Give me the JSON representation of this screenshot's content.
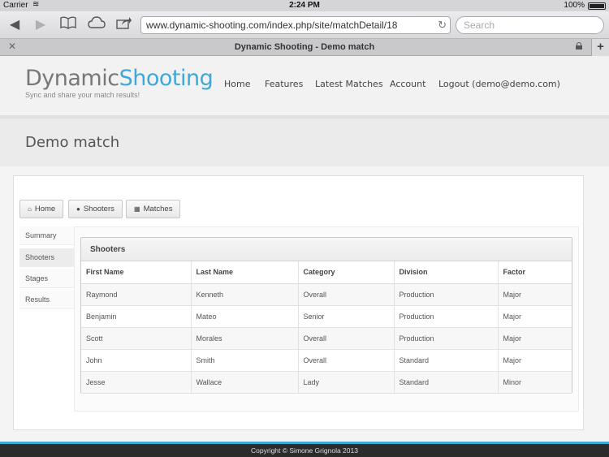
{
  "status_bar": {
    "carrier": "Carrier",
    "time": "2:24 PM",
    "battery": "100%"
  },
  "browser": {
    "url": "www.dynamic-shooting.com/index.php/site/matchDetail/18",
    "search_placeholder": "Search",
    "tab_title": "Dynamic Shooting - Demo match"
  },
  "site": {
    "logo_part1": "Dynamic",
    "logo_part2": "Shooting",
    "tagline": "Sync and share your match results!",
    "nav": [
      "Home",
      "Features",
      "Latest Matches",
      "Account",
      "Logout (demo@demo.com)"
    ]
  },
  "page_title": "Demo match",
  "buttons": {
    "home": "Home",
    "shooters": "Shooters",
    "matches": "Matches"
  },
  "side_menu": [
    "Summary",
    "Shooters",
    "Stages",
    "Results"
  ],
  "panel_title": "Shooters",
  "table": {
    "headers": [
      "First Name",
      "Last Name",
      "Category",
      "Division",
      "Factor"
    ],
    "rows": [
      [
        "Raymond",
        "Kenneth",
        "Overall",
        "Production",
        "Major"
      ],
      [
        "Benjamin",
        "Mateo",
        "Senior",
        "Production",
        "Major"
      ],
      [
        "Scott",
        "Morales",
        "Overall",
        "Production",
        "Major"
      ],
      [
        "John",
        "Smith",
        "Overall",
        "Standard",
        "Major"
      ],
      [
        "Jesse",
        "Wallace",
        "Lady",
        "Standard",
        "Minor"
      ]
    ]
  },
  "footer": "Copyright © Simone Grignola 2013",
  "colors": {
    "accent": "#3ea9d7",
    "footer_bg": "#2b2b2b"
  }
}
